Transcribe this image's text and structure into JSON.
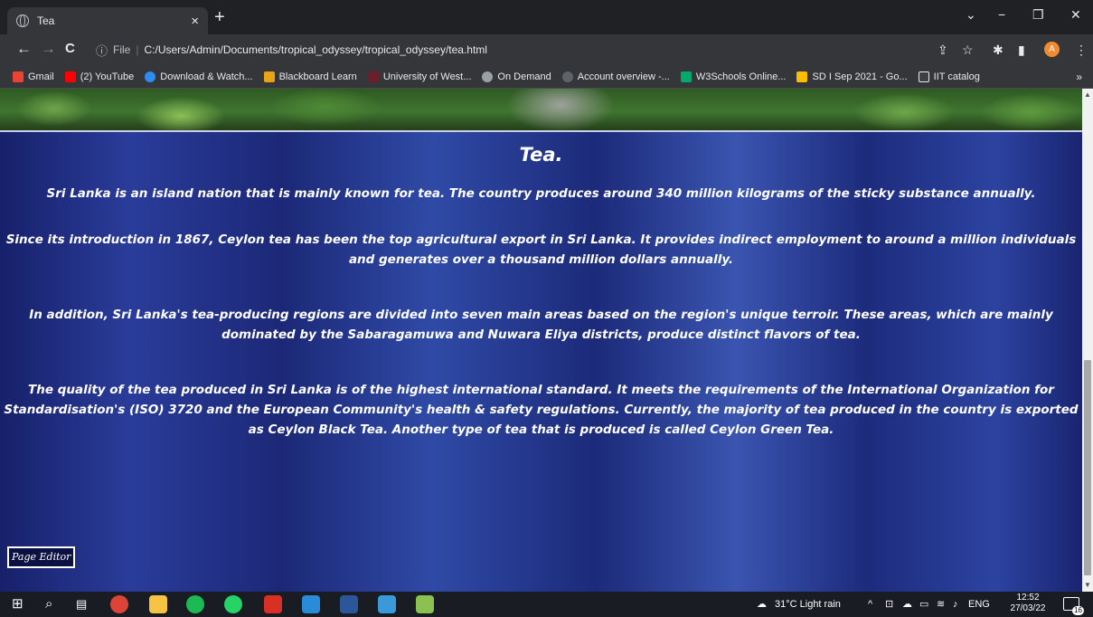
{
  "browser": {
    "tab_title": "Tea",
    "tab_close": "×",
    "new_tab": "+",
    "window_controls": {
      "menu": "⌄",
      "minimize": "−",
      "restore": "❐",
      "close": "✕"
    },
    "nav": {
      "back": "←",
      "forward": "→",
      "reload": "C"
    },
    "address": {
      "scheme_label": "File",
      "url": "C:/Users/Admin/Documents/tropical_odyssey/tropical_odyssey/tea.html"
    },
    "profile_initial": "A",
    "bookmarks": [
      {
        "label": "Gmail",
        "color": "#ea4335"
      },
      {
        "label": "(2) YouTube",
        "color": "#ff0000"
      },
      {
        "label": "Download & Watch...",
        "color": "#2d8cf0"
      },
      {
        "label": "Blackboard Learn",
        "color": "#e8a317"
      },
      {
        "label": "University of West...",
        "color": "#6b1f2a"
      },
      {
        "label": "On Demand",
        "color": "#9aa0a6"
      },
      {
        "label": "Account overview -...",
        "color": "#5f6368"
      },
      {
        "label": "W3Schools Online...",
        "color": "#04aa6d"
      },
      {
        "label": "SD I Sep 2021 - Go...",
        "color": "#fbbc04"
      },
      {
        "label": "IIT catalog",
        "color": "#3c4043"
      }
    ],
    "bookmarks_more": "»"
  },
  "page": {
    "heading": "Tea.",
    "paragraph_1": "Sri Lanka is an island nation that is mainly known for tea. The country produces around 340 million kilograms of the sticky substance annually.",
    "paragraph_2": "Since its introduction in 1867, Ceylon tea has been the top agricultural export in Sri Lanka. It provides indirect employment to around a million individuals and generates over a thousand million dollars annually.",
    "paragraph_3": "In addition, Sri Lanka's tea-producing regions are divided into seven main areas based on the region's unique terroir. These areas, which are mainly dominated by the Sabaragamuwa and Nuwara Eliya districts, produce distinct flavors of tea.",
    "paragraph_4": "The quality of the tea produced in Sri Lanka is of the highest international standard. It meets the requirements of the International Organization for Standardisation's (ISO) 3720 and the European Community's health & safety regulations. Currently, the majority of tea produced in the country is exported as Ceylon Black Tea. Another type of tea that is produced is called Ceylon Green Tea.",
    "page_editor_button": "Page Editor"
  },
  "taskbar": {
    "weather": "31°C  Light rain",
    "language": "ENG",
    "time": "12:52",
    "date": "27/03/22",
    "notification_count": "16"
  }
}
